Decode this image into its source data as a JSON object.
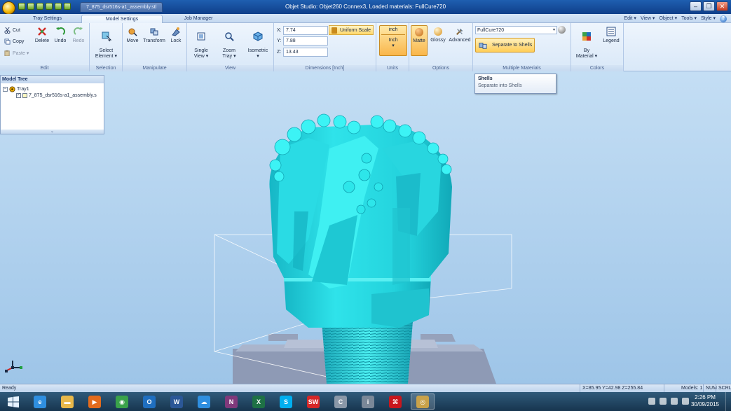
{
  "title_bar": {
    "doc_tab": "7_875_dsr516s-a1_assembly.stl",
    "window_title": "Objet Studio: Objet260 Connex3,   Loaded materials: FullCure720",
    "minimize": "–",
    "restore": "❐",
    "close": "✕"
  },
  "tabs": [
    {
      "label": "Tray Settings"
    },
    {
      "label": "Model Settings"
    },
    {
      "label": "Job Manager"
    }
  ],
  "menus": [
    "Edit ▾",
    "View ▾",
    "Object ▾",
    "Tools ▾",
    "Style ▾"
  ],
  "help_glyph": "?",
  "ribbon": {
    "edit": {
      "label": "Edit",
      "cut": "Cut",
      "copy": "Copy",
      "paste": "Paste ▾",
      "delete": "Delete",
      "undo": "Undo",
      "redo": "Redo"
    },
    "selection": {
      "label": "Selection",
      "select_element": "Select\nElement ▾"
    },
    "manipulate": {
      "label": "Manipulate",
      "move": "Move",
      "transform": "Transform",
      "lock": "Lock"
    },
    "view": {
      "label": "View",
      "single_view": "Single\nView ▾",
      "zoom_tray": "Zoom\nTray ▾",
      "isometric": "Isometric\n▾"
    },
    "dimensions": {
      "label": "Dimensions [Inch]",
      "x_label": "X:",
      "x_value": "7.74",
      "y_label": "Y:",
      "y_value": "7.88",
      "z_label": "Z:",
      "z_value": "13.43",
      "uniform_scale": "Uniform Scale"
    },
    "units": {
      "label": "Units",
      "top": "inch",
      "value": "Inch",
      "arrow": "▾"
    },
    "options": {
      "label": "Options",
      "matte": "Matte",
      "glossy": "Glossy",
      "advanced": "Advanced"
    },
    "multiple_materials": {
      "label": "Multiple Materials",
      "material": "FullCure720",
      "separate_to_shells": "Separate to Shells"
    },
    "colors": {
      "label": "Colors",
      "by_material": "By\nMaterial ▾",
      "legend": "Legend"
    }
  },
  "tooltip": {
    "title": "Shells",
    "body": "Separate into Shells"
  },
  "model_tree": {
    "header": "Model Tree",
    "tray": "Tray1",
    "item": "7_875_dsr516s-a1_assembly.s",
    "expand_glyph": "−",
    "check_glyph": "✓",
    "footer_glyph": "⌄"
  },
  "status_bar": {
    "ready": "Ready",
    "coords": "X=85.95 Y=42.98 Z=255.84",
    "models": "Models: 1",
    "num": "NUM",
    "scrl": "SCRL"
  },
  "taskbar": {
    "time": "2:26 PM",
    "date": "30/09/2015",
    "apps": [
      {
        "name": "ie",
        "glyph": "e",
        "color": "#2f8fe0"
      },
      {
        "name": "explorer",
        "glyph": "▬",
        "color": "#e8b84a"
      },
      {
        "name": "media",
        "glyph": "▶",
        "color": "#e36b1c"
      },
      {
        "name": "chrome",
        "glyph": "◉",
        "color": "#3aa24a"
      },
      {
        "name": "outlook",
        "glyph": "O",
        "color": "#1f6fc0"
      },
      {
        "name": "word",
        "glyph": "W",
        "color": "#2b5797"
      },
      {
        "name": "onedrive",
        "glyph": "☁",
        "color": "#2f8fe0"
      },
      {
        "name": "onenote",
        "glyph": "N",
        "color": "#80397b"
      },
      {
        "name": "excel",
        "glyph": "X",
        "color": "#1e7145"
      },
      {
        "name": "skype",
        "glyph": "S",
        "color": "#00aff0"
      },
      {
        "name": "solidworks",
        "glyph": "SW",
        "color": "#d62828"
      },
      {
        "name": "app-c",
        "glyph": "C",
        "color": "#8a98a8"
      },
      {
        "name": "info",
        "glyph": "i",
        "color": "#7a8898"
      },
      {
        "name": "acrobat",
        "glyph": "⌘",
        "color": "#c8161d"
      },
      {
        "name": "objet",
        "glyph": "◎",
        "color": "#c9a24a"
      }
    ]
  }
}
